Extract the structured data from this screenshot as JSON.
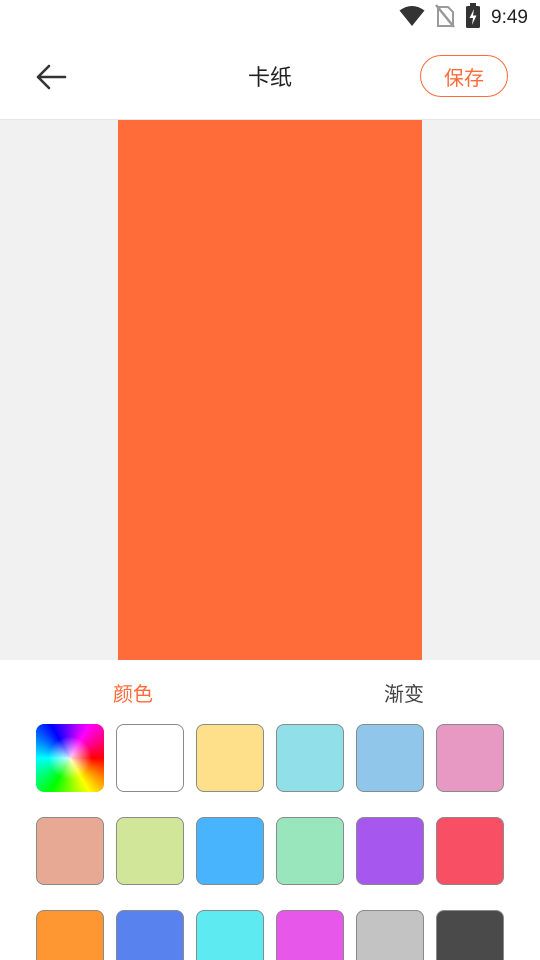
{
  "status_bar": {
    "time": "9:49",
    "icons": [
      "wifi-icon",
      "no-sim-icon",
      "battery-charging-icon"
    ]
  },
  "app_bar": {
    "title": "卡纸",
    "back_icon": "arrow-left-icon",
    "save_label": "保存",
    "accent_color": "#ff6b39"
  },
  "preview": {
    "background_color": "#f1f1f1",
    "card_color": "#ff6b39"
  },
  "tabs": [
    {
      "label": "颜色",
      "selected": true
    },
    {
      "label": "渐变",
      "selected": false
    }
  ],
  "colors": {
    "tab_selected": "#ff6b39",
    "tab_unselected": "#444444"
  },
  "swatches": [
    {
      "name": "rainbow-picker",
      "color": "rainbow"
    },
    {
      "name": "white",
      "color": "#ffffff"
    },
    {
      "name": "pale-yellow",
      "color": "#ffe08a"
    },
    {
      "name": "light-cyan",
      "color": "#90dfe9"
    },
    {
      "name": "light-blue",
      "color": "#90c6e9"
    },
    {
      "name": "pink",
      "color": "#e899c3"
    },
    {
      "name": "salmon",
      "color": "#e8a994"
    },
    {
      "name": "pale-green",
      "color": "#d1e699"
    },
    {
      "name": "sky-blue",
      "color": "#48b4fe"
    },
    {
      "name": "mint",
      "color": "#99e6bd"
    },
    {
      "name": "purple",
      "color": "#a658ee"
    },
    {
      "name": "red",
      "color": "#f84f65"
    },
    {
      "name": "orange",
      "color": "#fe9631"
    },
    {
      "name": "royal-blue",
      "color": "#5882ee"
    },
    {
      "name": "aqua",
      "color": "#5eeaf1"
    },
    {
      "name": "magenta",
      "color": "#e657ea"
    },
    {
      "name": "gray",
      "color": "#c3c3c3"
    },
    {
      "name": "dark-gray",
      "color": "#4a4a4a"
    }
  ]
}
